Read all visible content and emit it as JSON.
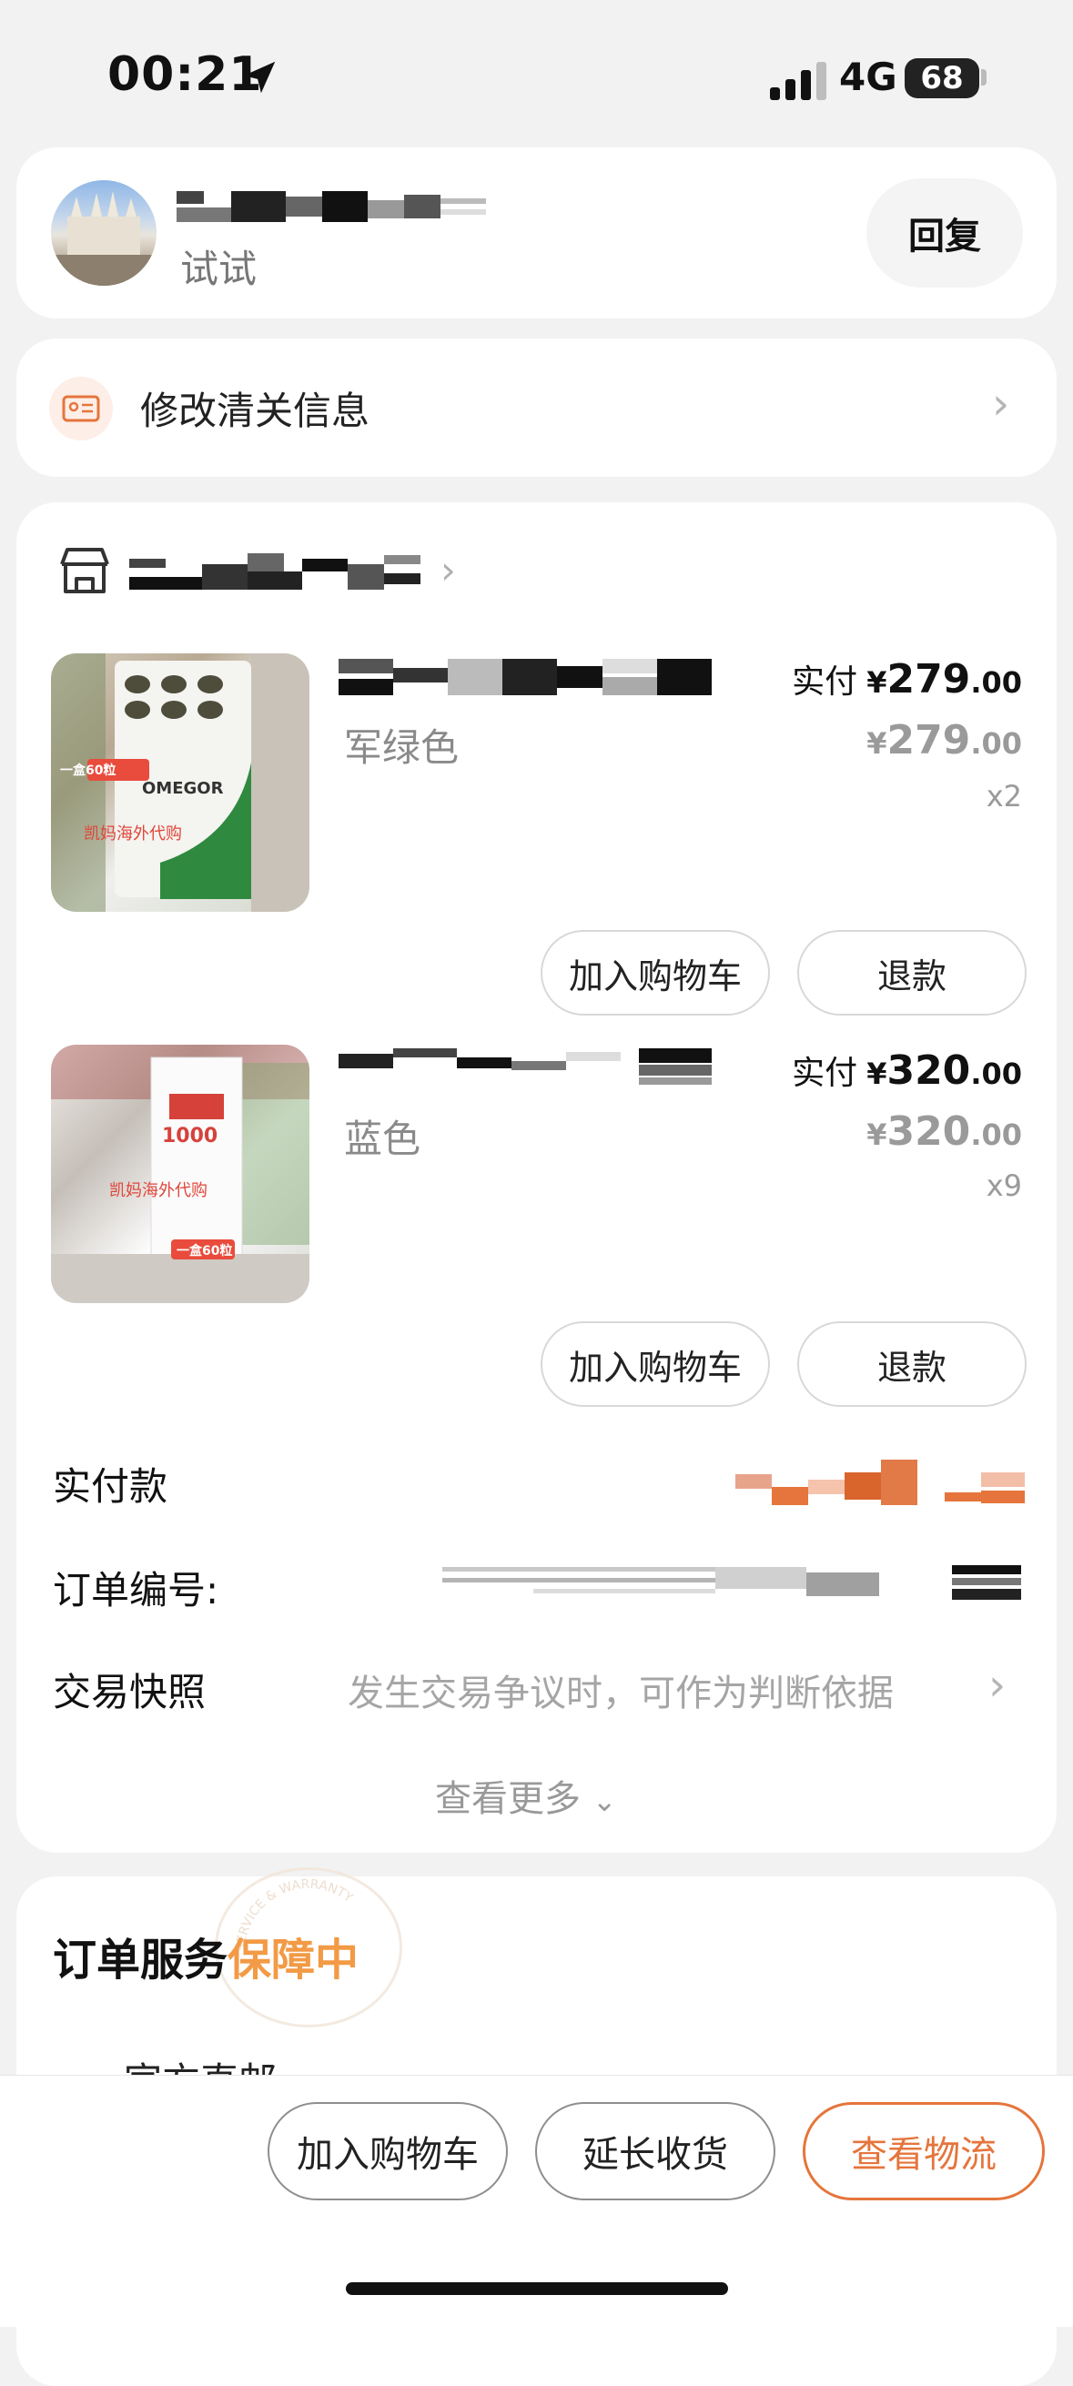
{
  "status_bar": {
    "time": "00:21",
    "network": "4G",
    "battery": "68"
  },
  "chat": {
    "subtitle": "试试",
    "reply_label": "回复"
  },
  "customs": {
    "label": "修改清关信息"
  },
  "products": [
    {
      "variant": "军绿色",
      "paid_label": "实付",
      "currency": "¥",
      "paid_int": "279",
      "paid_dec": ".00",
      "orig_int": "279",
      "orig_dec": ".00",
      "qty": "x2",
      "badge": "一盒60粒",
      "brand": "OMEGOR",
      "watermark": "凯妈海外代购"
    },
    {
      "variant": "蓝色",
      "paid_label": "实付",
      "currency": "¥",
      "paid_int": "320",
      "paid_dec": ".00",
      "orig_int": "320",
      "orig_dec": ".00",
      "qty": "x9",
      "badge": "一盒60粒",
      "label_num": "1000",
      "watermark": "凯妈海外代购"
    }
  ],
  "actions": {
    "add_cart": "加入购物车",
    "refund": "退款"
  },
  "order_rows": {
    "paid_total_label": "实付款",
    "order_no_label": "订单编号:",
    "snapshot_label": "交易快照",
    "snapshot_hint": "发生交易争议时，可作为判断依据",
    "see_more": "查看更多"
  },
  "service": {
    "title": "订单服务",
    "tag": "保障中",
    "stamp_text": "SERVICE & WARRANTY",
    "next_item": "官方直邮"
  },
  "bottom_bar": {
    "add_cart": "加入购物车",
    "extend": "延长收货",
    "logistics": "查看物流"
  },
  "colors": {
    "accent": "#e5753c",
    "guarantee": "#f29a45",
    "muted": "#999999"
  }
}
